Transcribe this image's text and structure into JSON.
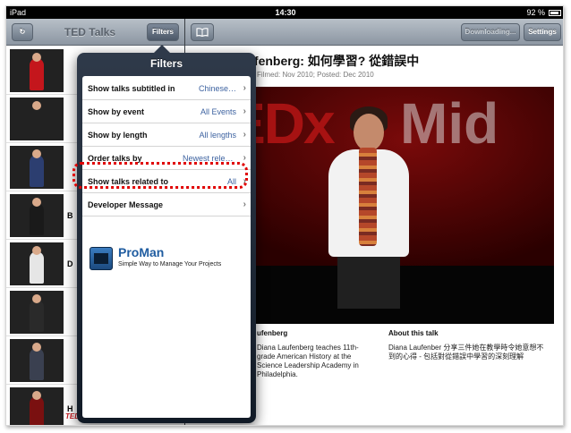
{
  "status": {
    "carrier": "iPad",
    "time": "14:30",
    "battery": "92 %"
  },
  "left_toolbar": {
    "title": "TED Talks",
    "filters_label": "Filters"
  },
  "right_toolbar": {
    "downloading_label": "Downloading...",
    "settings_label": "Settings"
  },
  "talk_list": {
    "items": [
      {
        "letter": "",
        "red": "",
        "jacket": "#c4161c"
      },
      {
        "letter": "",
        "red": "",
        "jacket": "#222222"
      },
      {
        "letter": "",
        "red": "",
        "jacket": "#2c3e70"
      },
      {
        "letter": "B",
        "red": "",
        "jacket": "#1a1a1a"
      },
      {
        "letter": "D",
        "red": "",
        "jacket": "#e6e6e6"
      },
      {
        "letter": "",
        "red": "",
        "jacket": "#2a2a2a"
      },
      {
        "letter": "",
        "red": "",
        "jacket": "#3a4050"
      },
      {
        "letter": "H",
        "red": "",
        "jacket": "#7a1010"
      }
    ],
    "tedwomen": "TEDWomen"
  },
  "detail": {
    "title": "Diana Laufenberg: 如何學習? 從錯誤中",
    "meta": "Filmed: Nov 2010; Posted: Dec 2010",
    "video": {
      "tedx": "TEDx",
      "mic": "Mid"
    },
    "speaker_head": "ufenberg",
    "speaker_bio": "Diana Laufenberg teaches 11th-grade American History at the Science Leadership Academy in Philadelphia.",
    "about_head": "About this talk",
    "about_text": "Diana Laufenber 分享三件她在教學時令她意想不到的心得 - 包括對從錯誤中學習的深刻理解"
  },
  "popover": {
    "title": "Filters",
    "rows": [
      {
        "label": "Show talks subtitled in",
        "value": "Chinese…"
      },
      {
        "label": "Show by event",
        "value": "All Events"
      },
      {
        "label": "Show by length",
        "value": "All lengths"
      },
      {
        "label": "Order talks by",
        "value": "Newest releases"
      },
      {
        "label": "Show talks related to",
        "value": "All"
      },
      {
        "label": "Developer Message",
        "value": ""
      }
    ],
    "ad": {
      "name": "ProMan",
      "tagline": "Simple Way to Manage Your Projects"
    }
  },
  "colors": {
    "accent_red": "#c4161c",
    "link_blue": "#3d62a0",
    "highlight": "#e00000"
  }
}
